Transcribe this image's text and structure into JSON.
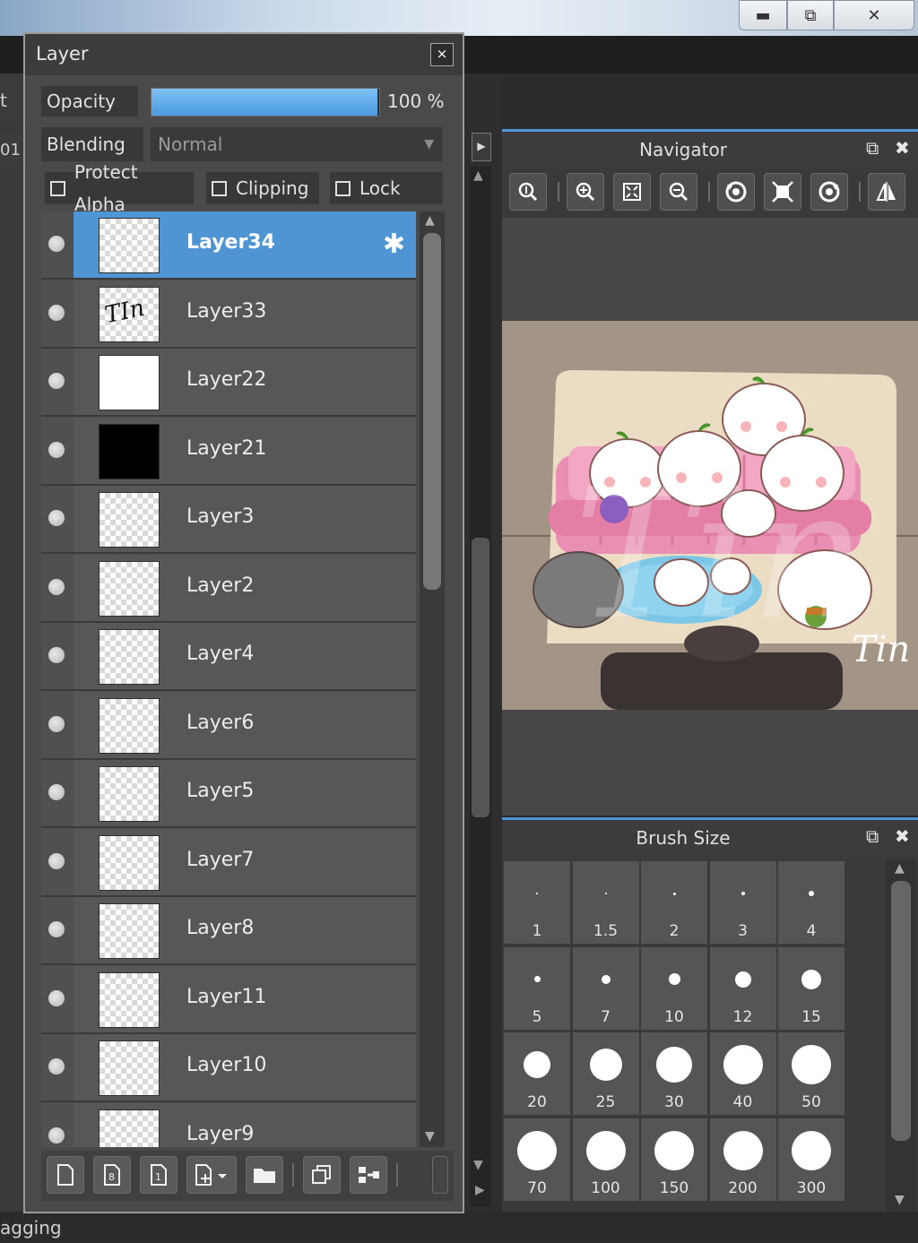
{
  "window": {
    "minimize_symbol": "▬",
    "maximize_symbol": "⧉",
    "close_symbol": "✕"
  },
  "status": {
    "text": "agging"
  },
  "left_edge": {
    "tab1": "t Ec",
    "tab2": "01"
  },
  "layer_panel": {
    "title": "Layer",
    "close_symbol": "×",
    "opacity_label": "Opacity",
    "opacity_value": "100 %",
    "opacity_fraction": 1.0,
    "blending_label": "Blending",
    "blending_value": "Normal",
    "checkboxes": {
      "protect_alpha": "Protect Alpha",
      "clipping": "Clipping",
      "lock": "Lock"
    },
    "layers": [
      {
        "name": "Layer34",
        "selected": true,
        "thumb": "checker"
      },
      {
        "name": "Layer33",
        "selected": false,
        "thumb": "text-tin"
      },
      {
        "name": "Layer22",
        "selected": false,
        "thumb": "white"
      },
      {
        "name": "Layer21",
        "selected": false,
        "thumb": "black"
      },
      {
        "name": "Layer3",
        "selected": false,
        "thumb": "checker"
      },
      {
        "name": "Layer2",
        "selected": false,
        "thumb": "checker"
      },
      {
        "name": "Layer4",
        "selected": false,
        "thumb": "checker"
      },
      {
        "name": "Layer6",
        "selected": false,
        "thumb": "checker"
      },
      {
        "name": "Layer5",
        "selected": false,
        "thumb": "checker"
      },
      {
        "name": "Layer7",
        "selected": false,
        "thumb": "checker"
      },
      {
        "name": "Layer8",
        "selected": false,
        "thumb": "checker"
      },
      {
        "name": "Layer11",
        "selected": false,
        "thumb": "checker"
      },
      {
        "name": "Layer10",
        "selected": false,
        "thumb": "checker"
      },
      {
        "name": "Layer9",
        "selected": false,
        "thumb": "checker"
      }
    ],
    "layer_thumb_text": "TIn",
    "toolbar_icons": [
      "new-layer-icon",
      "new-8bit-layer-icon",
      "new-1bit-layer-icon",
      "add-layer-menu-icon",
      "new-folder-icon",
      "duplicate-layer-icon",
      "merge-down-icon"
    ]
  },
  "navigator": {
    "title": "Navigator",
    "tools": [
      "zoom-reset-icon",
      "zoom-in-icon",
      "fit-icon",
      "zoom-out-icon",
      "rotate-left-icon",
      "full-view-icon",
      "rotate-right-icon",
      "flip-horizontal-icon"
    ],
    "signature": "Tin",
    "watermark": "Tin"
  },
  "brush_size": {
    "title": "Brush Size",
    "sizes": [
      "1",
      "1.5",
      "2",
      "3",
      "4",
      "5",
      "7",
      "10",
      "12",
      "15",
      "20",
      "25",
      "30",
      "40",
      "50",
      "70",
      "100",
      "150",
      "200",
      "300"
    ]
  },
  "colors": {
    "accent": "#4f95d3",
    "panel": "#4a4a4a",
    "sofa": "#e98fb3",
    "rug": "#7cc7e6"
  }
}
